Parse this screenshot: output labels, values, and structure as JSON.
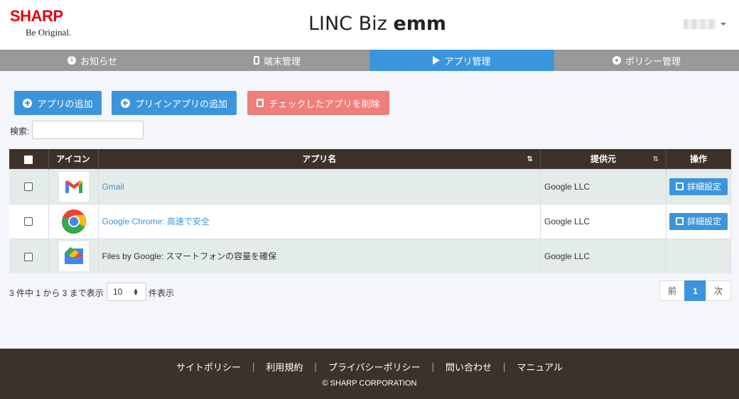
{
  "brand": {
    "logo": "SHARP",
    "tagline": "Be Original."
  },
  "header": {
    "title_light": "LINC Biz ",
    "title_bold": "emm",
    "user_menu_icon": "chevron-down-icon"
  },
  "nav": {
    "items": [
      {
        "label": "お知らせ",
        "icon": "info-icon"
      },
      {
        "label": "端末管理",
        "icon": "phone-icon"
      },
      {
        "label": "アプリ管理",
        "icon": "play-icon",
        "active": true
      },
      {
        "label": "ポリシー管理",
        "icon": "gear-icon"
      }
    ],
    "active_color": "#3b95dd"
  },
  "actions": {
    "add_app": "アプリの追加",
    "add_preinstalled": "プリインアプリの追加",
    "delete_checked": "チェックしたアプリを削除"
  },
  "search": {
    "label": "検索:",
    "value": ""
  },
  "table": {
    "headers": {
      "icon": "アイコン",
      "name": "アプリ名",
      "provider": "提供元",
      "operation": "操作"
    },
    "rows": [
      {
        "name": "Gmail",
        "provider": "Google LLC",
        "icon": "gmail-icon",
        "linked": true,
        "action": "詳細設定"
      },
      {
        "name": "Google Chrome: 高速で安全",
        "provider": "Google LLC",
        "icon": "chrome-icon",
        "linked": true,
        "action": "詳細設定"
      },
      {
        "name": "Files by Google: スマートフォンの容量を確保",
        "provider": "Google LLC",
        "icon": "files-icon",
        "linked": false,
        "action": ""
      }
    ]
  },
  "pagination": {
    "info_prefix": "3 件中 1 から 3 まで表示",
    "page_size": "10",
    "info_suffix": "件表示",
    "prev": "前",
    "current": "1",
    "next": "次"
  },
  "footer": {
    "links": [
      "サイトポリシー",
      "利用規約",
      "プライバシーポリシー",
      "問い合わせ",
      "マニュアル"
    ],
    "separator": "|",
    "copyright": "© SHARP CORPORATION"
  },
  "colors": {
    "header_dark": "#3d3229",
    "primary": "#3b95dd",
    "danger": "#ef7f7b",
    "brand_red": "#e60012"
  }
}
